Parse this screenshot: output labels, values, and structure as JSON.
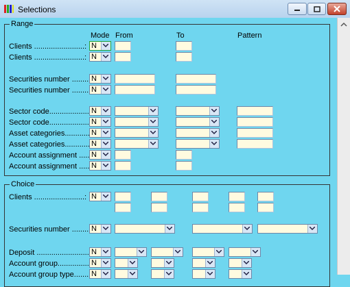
{
  "window": {
    "title": "Selections"
  },
  "range": {
    "legend": "Range",
    "headers": {
      "mode": "Mode",
      "from": "From",
      "to": "To",
      "pattern": "Pattern"
    },
    "rows": [
      {
        "label": "Clients ........................:",
        "mode": "N"
      },
      {
        "label": "Clients ........................:",
        "mode": "N"
      },
      {
        "label": "Securities number ..........:",
        "mode": "N"
      },
      {
        "label": "Securities number ..........:",
        "mode": "N"
      },
      {
        "label": "Sector code...................:",
        "mode": "N"
      },
      {
        "label": "Sector code...................:",
        "mode": "N"
      },
      {
        "label": "Asset categories.............:",
        "mode": "N"
      },
      {
        "label": "Asset categories.............:",
        "mode": "N"
      },
      {
        "label": "Account assignment ........:",
        "mode": "N"
      },
      {
        "label": "Account assignment ........:",
        "mode": "N"
      }
    ]
  },
  "choice": {
    "legend": "Choice",
    "rows": [
      {
        "label": "Clients ........................:",
        "mode": "N"
      },
      {
        "label": "Securities number ..........:",
        "mode": "N"
      },
      {
        "label": "Deposit .........................:",
        "mode": "N"
      },
      {
        "label": "Account group.................:",
        "mode": "N"
      },
      {
        "label": "Account group type.........:",
        "mode": "N"
      }
    ]
  },
  "colors": {
    "background": "#6fd6ef",
    "field": "#fffbe0",
    "focus_border": "#22a03a"
  },
  "icons": [
    "app-icon",
    "minimize-icon",
    "maximize-icon",
    "close-icon",
    "scroll-up-icon",
    "dropdown-arrow-icon"
  ]
}
